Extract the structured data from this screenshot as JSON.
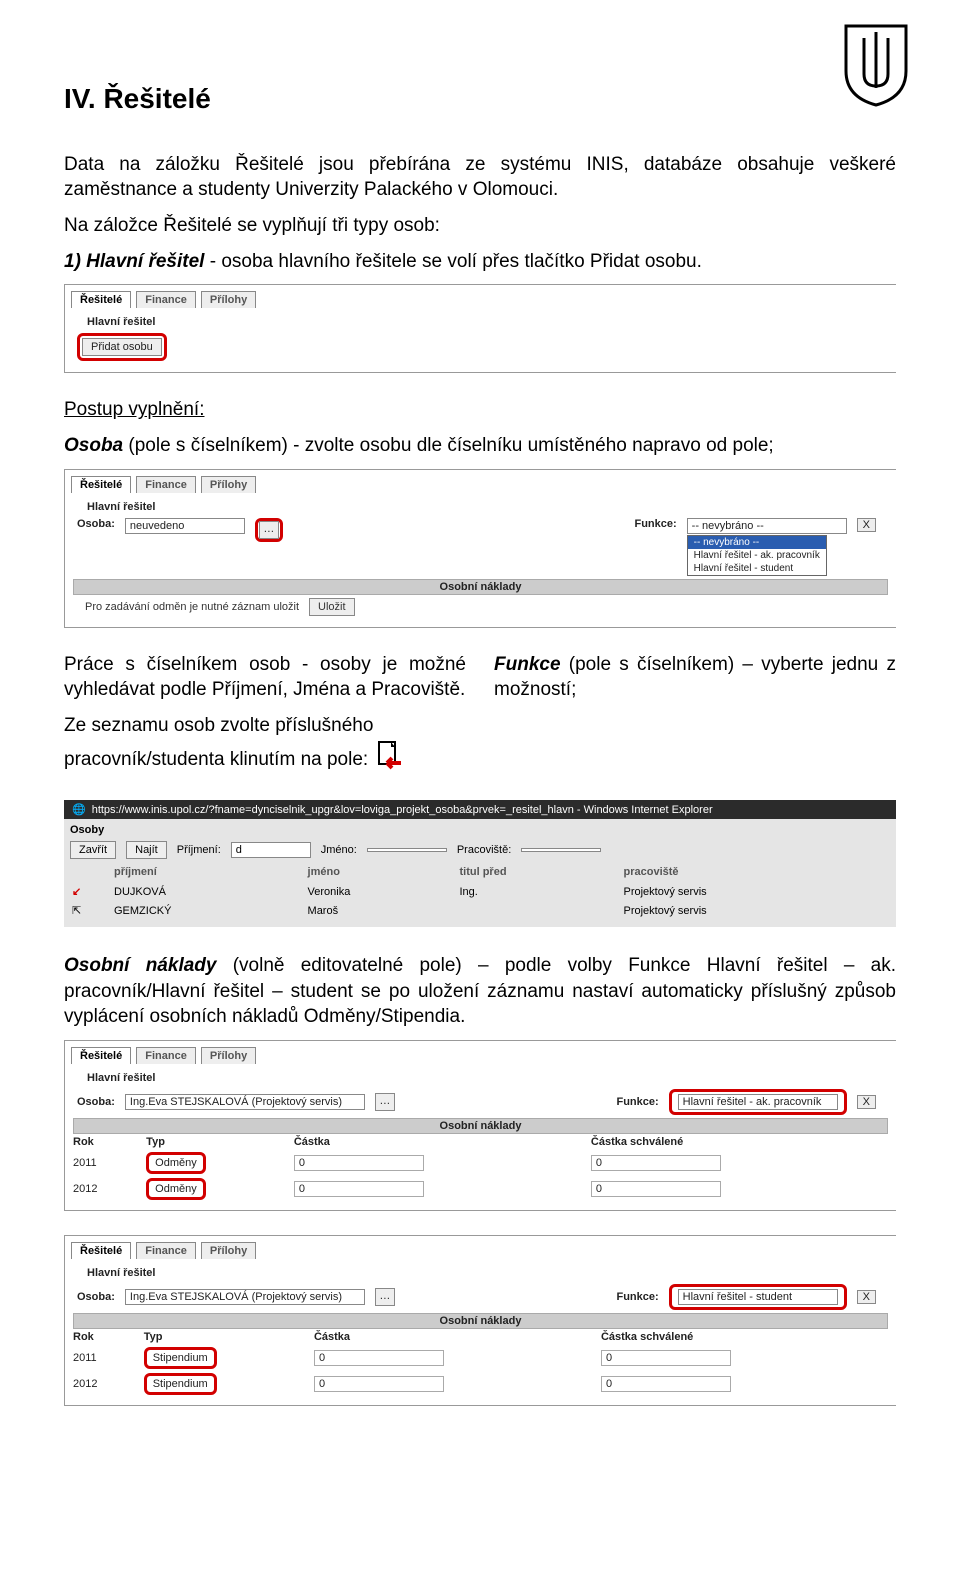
{
  "logo_alt": "UP logo",
  "heading": "IV. Řešitelé",
  "intro": "Data na záložku Řešitelé jsou přebírána ze systému INIS, databáze obsahuje veškeré zaměstnance a studenty Univerzity Palackého v Olomouci.",
  "line2a": "Na záložce Řešitelé se vyplňují tři typy osob:",
  "line2b_bold": "1) Hlavní řešitel",
  "line2b_rest": " - osoba hlavního řešitele se volí přes tlačítko Přidat osobu.",
  "screenshot1": {
    "tab_resitele": "Řešitelé",
    "tab_finance": "Finance",
    "tab_prilohy": "Přílohy",
    "section_label": "Hlavní řešitel",
    "add_button": "Přidat osobu"
  },
  "postup_label": "Postup vyplnění:",
  "postup_line_italic": "Osoba",
  "postup_line_rest": " (pole s číselníkem) - zvolte osobu dle číselníku umístěného napravo od pole;",
  "screenshot2": {
    "section_label": "Hlavní řešitel",
    "osoba_label": "Osoba:",
    "osoba_value": "neuvedeno",
    "lookup_icon": "…",
    "funkce_label": "Funkce:",
    "funkce_value": "-- nevybráno --",
    "options": [
      "-- nevybráno --",
      "Hlavní řešitel - ak. pracovník",
      "Hlavní řešitel - student"
    ],
    "x": "X",
    "section_bar": "Osobní náklady",
    "save_hint": "Pro zadávání odměn je nutné záznam uložit",
    "save_btn": "Uložit"
  },
  "col_left_1": "Práce s číselníkem osob - osoby je možné vyhledávat podle Příjmení, Jména a Pracoviště.",
  "col_left_2": "Ze seznamu osob zvolte příslušného pracovník/studenta klinutím na pole:",
  "col_right_bold": "Funkce",
  "col_right_rest": " (pole s číselníkem) – vyberte jednu z možností;",
  "ie": {
    "title": "https://www.inis.upol.cz/?fname=dynciselnik_upgr&lov=loviga_projekt_osoba&prvek=_resitel_hlavn - Windows Internet Explorer",
    "osoby": "Osoby",
    "zavrit": "Zavřít",
    "najit": "Najít",
    "prijmeni_label": "Příjmení:",
    "prijmeni_value": "d",
    "jmeno_label": "Jméno:",
    "pracoviste_label": "Pracoviště:",
    "h_prijmeni": "příjmení",
    "h_jmeno": "jméno",
    "h_titul": "titul před",
    "h_pracoviste": "pracoviště",
    "rows": [
      {
        "p": "DUJKOVÁ",
        "j": "Veronika",
        "t": "Ing.",
        "pr": "Projektový servis"
      },
      {
        "p": "GEMZICKÝ",
        "j": "Maroš",
        "t": "",
        "pr": "Projektový servis"
      }
    ]
  },
  "para3_bold": "Osobní náklady",
  "para3_rest": " (volně editovatelné pole) – podle volby Funkce Hlavní řešitel – ak. pracovník/Hlavní řešitel – student se po uložení záznamu nastaví automaticky příslušný způsob vyplácení osobních nákladů Odměny/Stipendia.",
  "screenshot3": {
    "section_label": "Hlavní řešitel",
    "osoba_label": "Osoba:",
    "osoba_value": "Ing.Eva STEJSKALOVÁ (Projektový servis)",
    "lookup_icon": "…",
    "funkce_label": "Funkce:",
    "funkce_value": "Hlavní řešitel - ak. pracovník",
    "x": "X",
    "section_bar": "Osobní náklady",
    "h_rok": "Rok",
    "h_typ": "Typ",
    "h_castka": "Částka",
    "h_schv": "Částka schválené",
    "y1": "2011",
    "y2": "2012",
    "typ1": "Odměny",
    "v": "0"
  },
  "screenshot4": {
    "section_label": "Hlavní řešitel",
    "osoba_label": "Osoba:",
    "osoba_value": "Ing.Eva STEJSKALOVÁ (Projektový servis)",
    "funkce_label": "Funkce:",
    "funkce_value": "Hlavní řešitel - student",
    "x": "X",
    "section_bar": "Osobní náklady",
    "h_rok": "Rok",
    "h_typ": "Typ",
    "h_castka": "Částka",
    "h_schv": "Částka schválené",
    "y1": "2011",
    "y2": "2012",
    "typ1": "Stipendium",
    "v": "0"
  }
}
